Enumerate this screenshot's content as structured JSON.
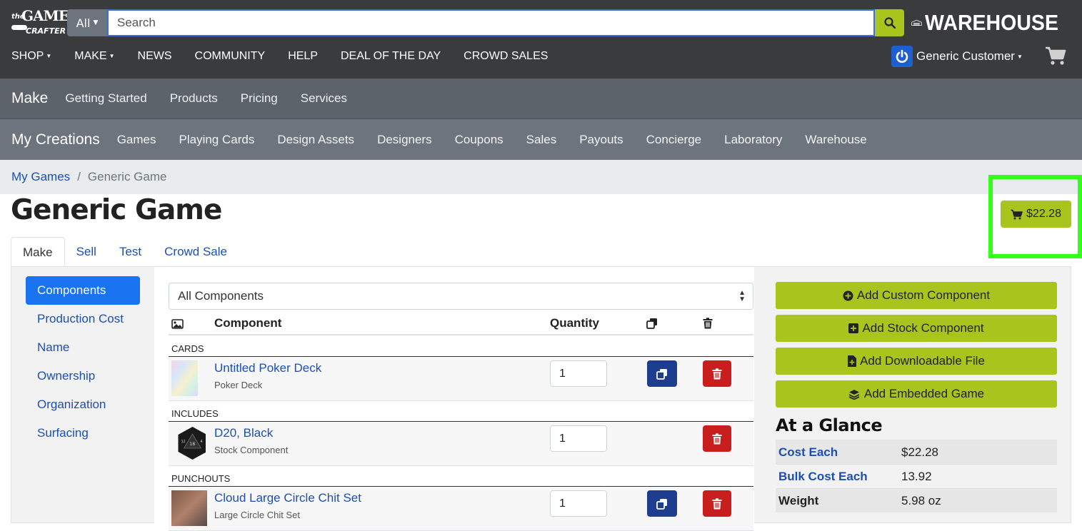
{
  "header": {
    "logo": {
      "the": "the",
      "game": "GAME",
      "crafter": "CRAFTER"
    },
    "search": {
      "category": "All",
      "placeholder": "Search"
    },
    "warehouse_logo": "WAREHOUSE",
    "nav": [
      "SHOP",
      "MAKE",
      "NEWS",
      "COMMUNITY",
      "HELP",
      "DEAL OF THE DAY",
      "CROWD SALES"
    ],
    "user_name": "Generic Customer"
  },
  "make_bar": {
    "title": "Make",
    "items": [
      "Getting Started",
      "Products",
      "Pricing",
      "Services"
    ]
  },
  "creations_bar": {
    "title": "My Creations",
    "items": [
      "Games",
      "Playing Cards",
      "Design Assets",
      "Designers",
      "Coupons",
      "Sales",
      "Payouts",
      "Concierge",
      "Laboratory",
      "Warehouse"
    ]
  },
  "breadcrumb": {
    "link": "My Games",
    "separator": "/",
    "current": "Generic Game"
  },
  "page_title": "Generic Game",
  "price_button": "$22.28",
  "tabs": [
    "Make",
    "Sell",
    "Test",
    "Crowd Sale"
  ],
  "sidenav": [
    "Components",
    "Production Cost",
    "Name",
    "Ownership",
    "Organization",
    "Surfacing"
  ],
  "components": {
    "filter": "All Components",
    "headers": {
      "component": "Component",
      "quantity": "Quantity"
    },
    "groups": [
      {
        "label": "CARDS",
        "rows": [
          {
            "name": "Untitled Poker Deck",
            "type": "Poker Deck",
            "qty": "1"
          }
        ]
      },
      {
        "label": "INCLUDES",
        "rows": [
          {
            "name": "D20, Black",
            "type": "Stock Component",
            "qty": "1"
          }
        ]
      },
      {
        "label": "PUNCHOUTS",
        "rows": [
          {
            "name": "Cloud Large Circle Chit Set",
            "type": "Large Circle Chit Set",
            "qty": "1"
          }
        ]
      }
    ]
  },
  "actions": [
    "Add Custom Component",
    "Add Stock Component",
    "Add Downloadable File",
    "Add Embedded Game"
  ],
  "glance": {
    "title": "At a Glance",
    "rows": [
      {
        "label": "Cost Each",
        "value": "$22.28"
      },
      {
        "label": "Bulk Cost Each",
        "value": "13.92"
      },
      {
        "label": "Weight",
        "value": "5.98 oz"
      }
    ]
  },
  "colors": {
    "accent": "#a8c41d",
    "link": "#1b4fb3",
    "highlight": "#33ff1a",
    "danger": "#c81e1e",
    "dup": "#1e3d8f"
  }
}
